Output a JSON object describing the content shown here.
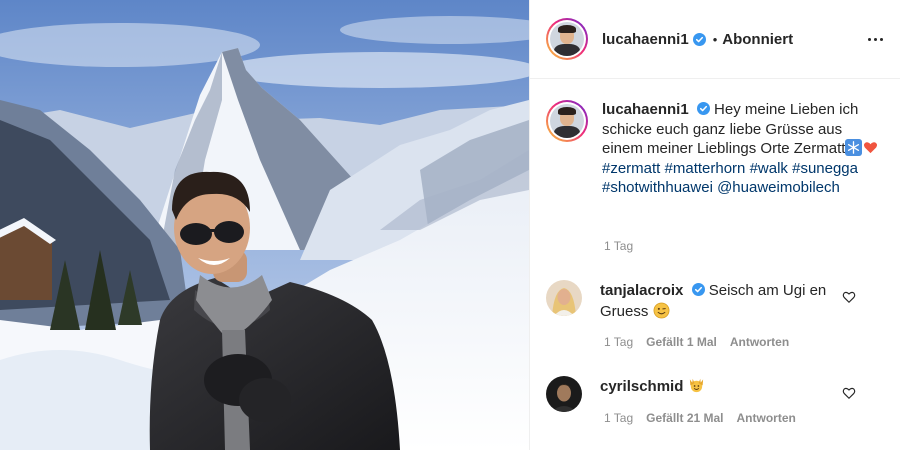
{
  "post": {
    "author": "lucahaenni1",
    "follow_state": "Abonniert",
    "separator": "•",
    "caption": {
      "username": "lucahaenni1",
      "text_part1": "Hey meine Lieben ich schicke euch ganz liebe Grüsse aus einem meiner Lieblings Orte Zermatt",
      "hashtags_line1": "#zermatt #matterhorn",
      "hashtags_line2": "#walk #sunegga #shotwithhuawei",
      "mention": "@huaweimobilech",
      "time": "1 Tag"
    }
  },
  "comments": [
    {
      "username": "tanjalacroix",
      "text": "Seisch am Ugi en Gruess",
      "time": "1 Tag",
      "likes": "Gefällt 1 Mal",
      "reply_label": "Antworten"
    },
    {
      "username": "cyrilschmid",
      "text": "",
      "time": "1 Tag",
      "likes": "Gefällt 21 Mal",
      "reply_label": "Antworten"
    }
  ],
  "colors": {
    "verified": "#3897f0",
    "hashtag": "#00376b",
    "meta": "#8e8e8e"
  }
}
